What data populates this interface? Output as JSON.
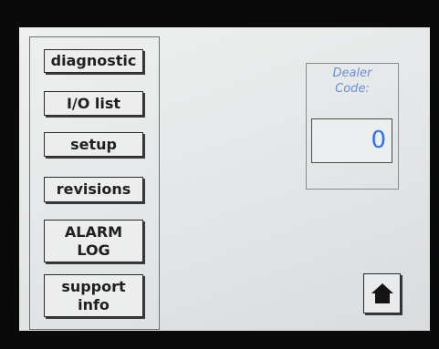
{
  "menu": {
    "items": [
      {
        "label": "diagnostic"
      },
      {
        "label": "I/O list"
      },
      {
        "label": "setup"
      },
      {
        "label": "revisions"
      },
      {
        "label": "ALARM\nLOG"
      },
      {
        "label": "support\ninfo"
      }
    ]
  },
  "dealer": {
    "label": "Dealer\nCode:",
    "value": "0"
  },
  "home": {
    "icon": "home-icon"
  },
  "colors": {
    "screen_background": "#e6e8e9",
    "dealer_label": "#6b8fd6",
    "dealer_value": "#2f6ff2",
    "button_border": "#2a2a2a"
  }
}
